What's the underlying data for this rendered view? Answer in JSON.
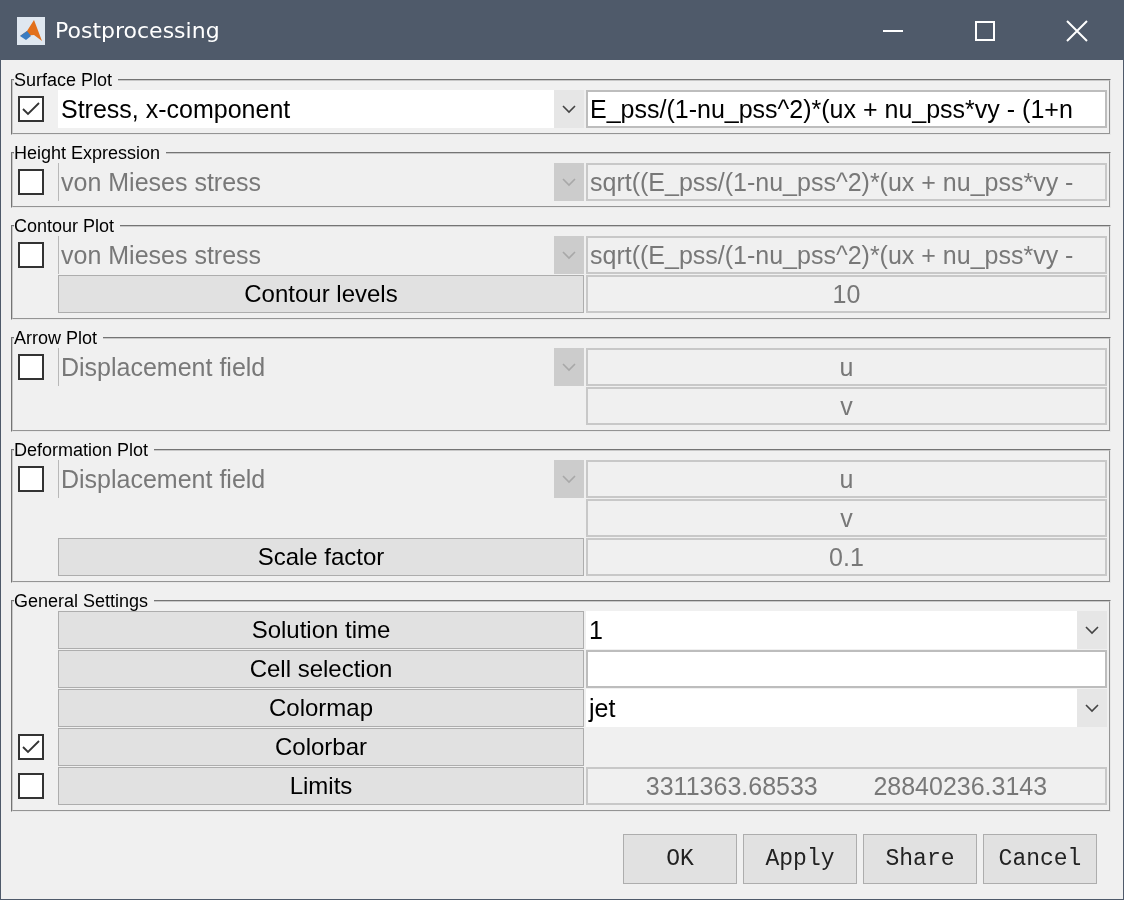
{
  "window": {
    "title": "Postprocessing"
  },
  "sections": [
    {
      "title": "Surface Plot",
      "rows": [
        {
          "checkbox": {
            "checked": true
          },
          "left": {
            "kind": "dropdown",
            "value": "Stress, x-component",
            "disabled": false
          },
          "right": {
            "kind": "expression",
            "value": "E_pss/(1-nu_pss^2)*(ux + nu_pss*vy - (1+n",
            "disabled": false
          }
        }
      ]
    },
    {
      "title": "Height Expression",
      "rows": [
        {
          "checkbox": {
            "checked": false
          },
          "left": {
            "kind": "dropdown",
            "value": "von Mieses stress",
            "disabled": true
          },
          "right": {
            "kind": "expression",
            "value": "sqrt((E_pss/(1-nu_pss^2)*(ux + nu_pss*vy -",
            "disabled": true
          }
        }
      ]
    },
    {
      "title": "Contour Plot",
      "rows": [
        {
          "checkbox": {
            "checked": false
          },
          "left": {
            "kind": "dropdown",
            "value": "von Mieses stress",
            "disabled": true
          },
          "right": {
            "kind": "expression",
            "value": "sqrt((E_pss/(1-nu_pss^2)*(ux + nu_pss*vy -",
            "disabled": true
          }
        },
        {
          "left": {
            "kind": "button",
            "value": "Contour levels"
          },
          "right": {
            "kind": "value",
            "value": "10",
            "disabled": true
          }
        }
      ]
    },
    {
      "title": "Arrow Plot",
      "rows": [
        {
          "checkbox": {
            "checked": false
          },
          "left": {
            "kind": "dropdown",
            "value": "Displacement field",
            "disabled": true
          },
          "right": {
            "kind": "value",
            "value": "u",
            "disabled": true
          }
        },
        {
          "left": {
            "kind": "blank"
          },
          "right": {
            "kind": "value",
            "value": "v",
            "disabled": true
          }
        }
      ]
    },
    {
      "title": "Deformation Plot",
      "rows": [
        {
          "checkbox": {
            "checked": false
          },
          "left": {
            "kind": "dropdown",
            "value": "Displacement field",
            "disabled": true
          },
          "right": {
            "kind": "value",
            "value": "u",
            "disabled": true
          }
        },
        {
          "left": {
            "kind": "blank"
          },
          "right": {
            "kind": "value",
            "value": "v",
            "disabled": true
          }
        },
        {
          "left": {
            "kind": "button",
            "value": "Scale factor"
          },
          "right": {
            "kind": "value",
            "value": "0.1",
            "disabled": true
          }
        }
      ]
    },
    {
      "title": "General Settings",
      "rows": [
        {
          "left": {
            "kind": "button",
            "value": "Solution time"
          },
          "right": {
            "kind": "dropdown",
            "value": "1",
            "disabled": false
          }
        },
        {
          "left": {
            "kind": "button",
            "value": "Cell selection"
          },
          "right": {
            "kind": "expression",
            "disabled": false
          }
        },
        {
          "left": {
            "kind": "button",
            "value": "Colormap"
          },
          "right": {
            "kind": "dropdown",
            "value": "jet",
            "disabled": false
          }
        },
        {
          "checkbox": {
            "checked": true
          },
          "left": {
            "kind": "button",
            "value": "Colorbar"
          },
          "right": {
            "kind": "blank"
          }
        },
        {
          "checkbox": {
            "checked": false
          },
          "left": {
            "kind": "button",
            "value": "Limits"
          },
          "right": {
            "kind": "pair",
            "values": [
              "3311363.68533",
              "28840236.3143"
            ],
            "disabled": true
          }
        }
      ]
    }
  ],
  "buttons": [
    "OK",
    "Apply",
    "Share",
    "Cancel"
  ]
}
